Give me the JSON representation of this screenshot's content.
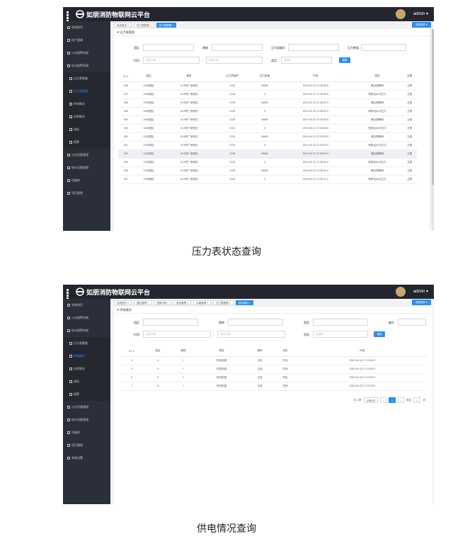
{
  "app": {
    "title": "如朋消防物联网云平台",
    "user": "admin ▾"
  },
  "shot1": {
    "sidebar": [
      "系统首页",
      "用户管理",
      "火灾报警系统",
      "给水报警系统",
      "压力表数据",
      "压力表管理",
      "供电情况",
      "启泵情况",
      "巡检",
      "报警",
      "火灾设备管理",
      "给水设备管理",
      "设备库",
      "项目管理"
    ],
    "tabs": [
      "系统首页 ×",
      "压力表数据 ×",
      "压力表管理 ×"
    ],
    "tab_ops": "标签操作 ▾",
    "panel_title": "☰ 压力表管理",
    "filters": {
      "park": "园区",
      "building": "建筑",
      "gauge_no": "压力表编号",
      "value": "压力数值",
      "time": "时间",
      "start": "选择日期",
      "end": "选择日期",
      "type": "类型",
      "type_ph": "请选择",
      "search": "搜索"
    },
    "columns": [
      "ID ⇕",
      "园区",
      "建筑",
      "压力表编号",
      "压力数值",
      "时间",
      "类型",
      "结果"
    ],
    "rows": [
      [
        "548",
        "1349园区",
        "49-5号厂房测试",
        "2135",
        "18660",
        "2019-04-13 17:35:56.0",
        "漏点报警阀",
        "正常"
      ],
      [
        "547",
        "1349园区",
        "49-5号厂房测试",
        "2134",
        "0",
        "2019-04-13 17:35:56.0",
        "喷淋出水口压力",
        "正常"
      ],
      [
        "546",
        "1349园区",
        "49-5号厂房测试",
        "2135",
        "18660",
        "2019-04-13 17:35:47.0",
        "漏点报警阀",
        "正常"
      ],
      [
        "545",
        "1349园区",
        "49-5号厂房测试",
        "2134",
        "0",
        "2019-04-13 17:35:47.0",
        "喷淋出水口压力",
        "正常"
      ],
      [
        "544",
        "1349园区",
        "49-5号厂房测试",
        "2135",
        "18660",
        "2019-04-13 17:35:38.0",
        "漏点报警阀",
        "正常"
      ],
      [
        "543",
        "1349园区",
        "49-5号厂房测试",
        "2134",
        "0",
        "2019-04-13 17:35:38.0",
        "喷淋出水口压力",
        "正常"
      ],
      [
        "542",
        "1349园区",
        "49-5号厂房测试",
        "2135",
        "18660",
        "2019-04-13 17:35:29.0",
        "漏点报警阀",
        "正常"
      ],
      [
        "541",
        "1349园区",
        "49-5号厂房测试",
        "2134",
        "0",
        "2019-04-13 17:35:29.0",
        "喷淋出水口压力",
        "正常"
      ],
      [
        "540",
        "1349园区",
        "49-5号厂房测试",
        "2135",
        "18660",
        "2019-04-13 17:35:20.0",
        "漏点报警阀",
        "正常"
      ],
      [
        "539",
        "1349园区",
        "49-5号厂房测试",
        "2134",
        "0",
        "2019-04-13 17:35:20.0",
        "喷淋出水口压力",
        "正常"
      ],
      [
        "538",
        "1349园区",
        "49-5号厂房测试",
        "2135",
        "18660",
        "2019-04-13 17:35:11.0",
        "漏点报警阀",
        "正常"
      ],
      [
        "537",
        "1349园区",
        "49-5号厂房测试",
        "2134",
        "0",
        "2019-04-13 17:35:11.0",
        "喷淋出水口压力",
        "正常"
      ]
    ],
    "caption": "压力表状态查询"
  },
  "shot2": {
    "sidebar": [
      "系统首页",
      "火灾报警系统",
      "给水报警系统",
      "压力表数据",
      "供电情况",
      "启泵情况",
      "巡检",
      "报警",
      "火灾设备管理",
      "给水设备管理",
      "设备库",
      "项目管理",
      "系统设置"
    ],
    "tabs": [
      "系统首页 ×",
      "园区管理 ×",
      "设备列表 ×",
      "报告管理 ×",
      "水箱管理 ×",
      "压力表数据 ×",
      "供电情况 ×"
    ],
    "tab_ops": "标签操作 ▾",
    "panel_title": "☰ 供电情况",
    "filters": {
      "park": "园区",
      "building": "建筑",
      "type": "类型",
      "number": "编号",
      "time": "时间",
      "start": "选择日期",
      "end": "选择日期",
      "status": "状态",
      "status_ph": "请选择",
      "search": "搜索"
    },
    "columns": [
      "ID ⇕",
      "园区",
      "建筑",
      "类型",
      "编号",
      "状态",
      "时间"
    ],
    "rows": [
      [
        "4",
        "b",
        "f",
        "供电电源",
        "主电",
        "开启",
        "2019-04-13 17:12:52.0"
      ],
      [
        "5",
        "b",
        "f",
        "供电电源",
        "主电",
        "关闭",
        "2019-04-13 17:13:03.0"
      ],
      [
        "6",
        "b",
        "f",
        "供电电源",
        "主电",
        "开启",
        "2019-04-13 17:13:09.0"
      ],
      [
        "7",
        "b",
        "f",
        "供电电源",
        "主电",
        "关闭",
        "2019-04-13 17:13:13.0"
      ]
    ],
    "pagination": {
      "total": "共 4 条",
      "size": "20条/页",
      "prev": "‹",
      "page": "1",
      "next": "›",
      "goto": "前往",
      "goto_val": "1",
      "unit": "页"
    },
    "caption": "供电情况查询"
  }
}
